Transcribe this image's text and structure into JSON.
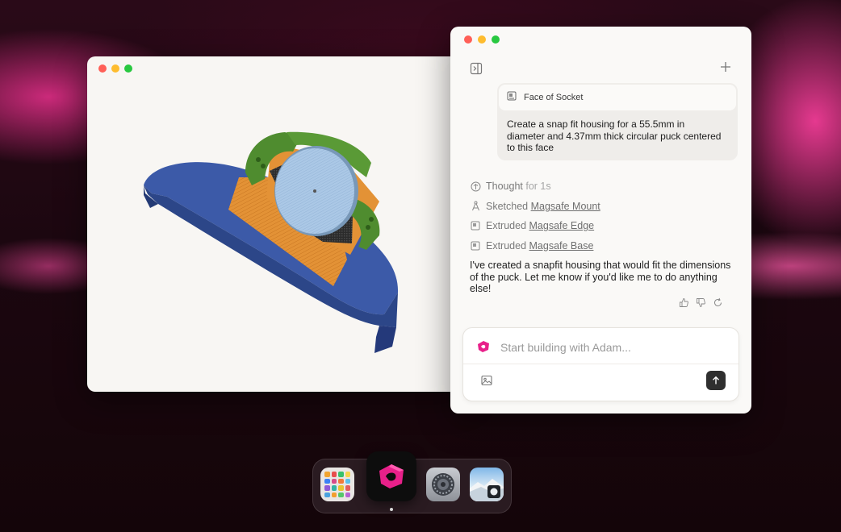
{
  "viewer_window": {
    "title": "",
    "colors": {
      "base": "#3c5aa8",
      "bracket": "#e39236",
      "clips": "#4f8c2f",
      "puck": "#a9c6e3"
    }
  },
  "chat_window": {
    "sidebar_toggle_icon": "sidebar-icon",
    "new_chat_icon": "plus-icon",
    "user_message": {
      "attachment_icon": "face-icon",
      "attachment_label": "Face of Socket",
      "text": "Create a snap fit housing for a 55.5mm in diameter and 4.37mm thick circular puck centered to this face"
    },
    "steps": [
      {
        "icon": "thought-icon",
        "verb": "Thought",
        "suffix": "for 1s",
        "link": ""
      },
      {
        "icon": "sketch-icon",
        "verb": "Sketched",
        "suffix": "",
        "link": "Magsafe Mount"
      },
      {
        "icon": "extrude-icon",
        "verb": "Extruded",
        "suffix": "",
        "link": "Magsafe Edge"
      },
      {
        "icon": "extrude-icon",
        "verb": "Extruded",
        "suffix": "",
        "link": "Magsafe Base"
      }
    ],
    "assistant_reply": "I've created a snapfit housing that would fit the dimensions of the puck. Let me know if you'd like me to do anything else!",
    "feedback_icons": [
      "thumbs-up-icon",
      "thumbs-down-icon",
      "retry-icon"
    ],
    "composer": {
      "placeholder": "Start building with Adam...",
      "value": "",
      "attach_icon": "image-icon",
      "send_icon": "arrow-up-icon",
      "brand_color": "#e8208a"
    }
  },
  "dock": {
    "apps": [
      {
        "name": "Launchpad",
        "icon": "launchpad-icon"
      },
      {
        "name": "Adam",
        "icon": "adam-icon",
        "active": true
      },
      {
        "name": "System Settings",
        "icon": "settings-icon"
      },
      {
        "name": "Preview",
        "icon": "preview-icon"
      }
    ]
  }
}
